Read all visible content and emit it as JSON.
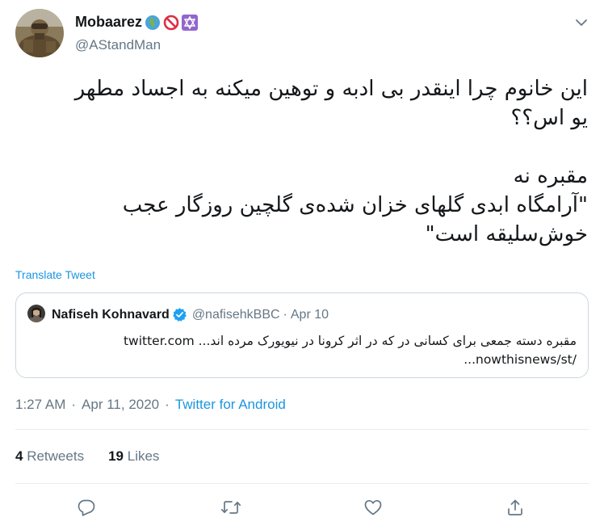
{
  "author": {
    "name": "Mobaarez",
    "name_emojis": [
      "globe-africa-icon",
      "prohibited-icon",
      "star-of-david-icon"
    ],
    "handle": "@AStandMan"
  },
  "tweet": {
    "lines": [
      "این خانوم چرا اینقدر بی ادبه و توهین میکنه به اجساد مطهر",
      "یو اس؟؟",
      "",
      "مقبره نه",
      "\"آرامگاه ابدی گلهای خزان شده‌ی گلچین روزگار عجب",
      "خوش‌سلیقه است\""
    ],
    "translate_label": "Translate Tweet"
  },
  "quoted": {
    "name": "Nafiseh Kohnavard",
    "handle": "@nafisehkBBC",
    "separator": "·",
    "date": "Apr 10",
    "text_line1": "مقبره دسته جمعی برای کسانی در که در اثر کرونا در نیویورک مرده اند... twitter.com",
    "text_line2": "/nowthisnews/st..."
  },
  "meta": {
    "time": "1:27 AM",
    "separator": "·",
    "date": "Apr 11, 2020",
    "source": "Twitter for Android"
  },
  "stats": {
    "retweets_count": "4",
    "retweets_label": "Retweets",
    "likes_count": "19",
    "likes_label": "Likes"
  },
  "actions": [
    "reply-icon",
    "retweet-icon",
    "like-icon",
    "share-icon"
  ],
  "colors": {
    "link": "#1b95e0",
    "secondary_text": "#657786",
    "primary_text": "#14171a",
    "border": "#ccd6dd",
    "verified": "#1da1f2"
  }
}
